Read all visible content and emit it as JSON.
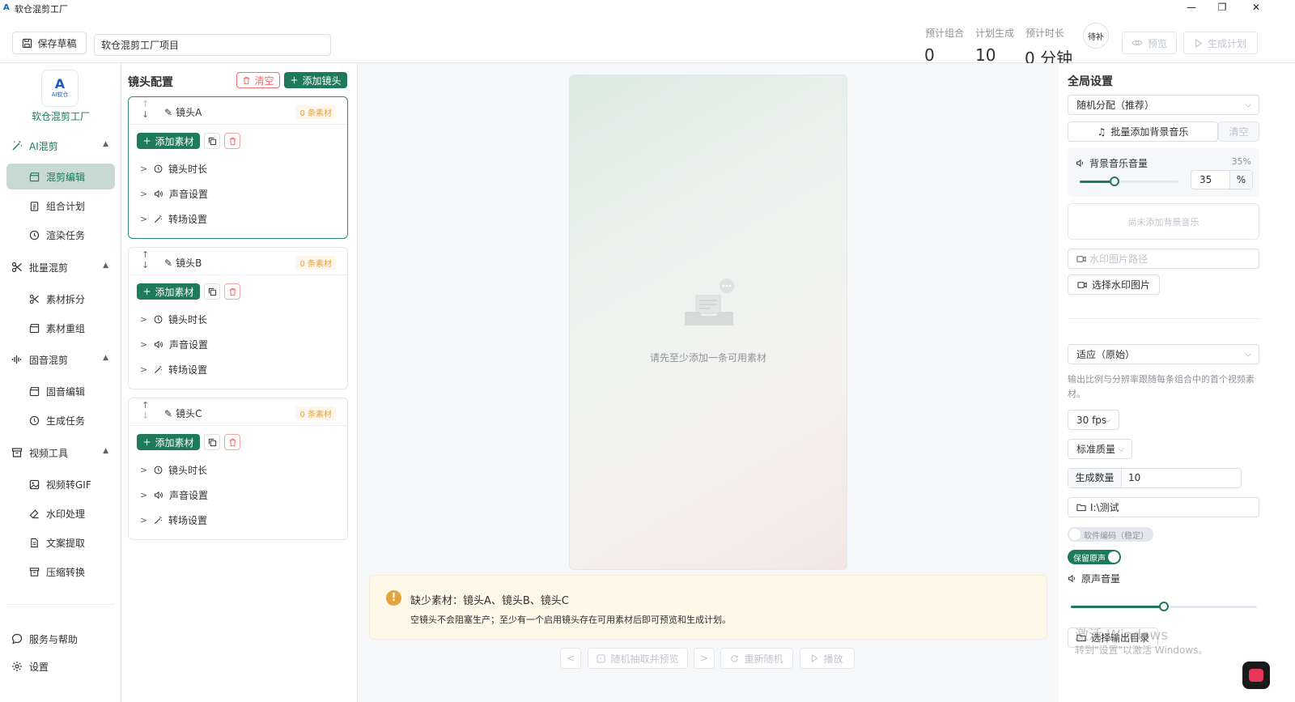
{
  "window": {
    "title": "软仓混剪工厂",
    "minimize": "—",
    "restore": "❐",
    "close": "✕"
  },
  "toolbar": {
    "save_draft": "保存草稿",
    "project_name": "软仓混剪工厂项目",
    "stats": [
      {
        "label": "预计组合",
        "value": "0"
      },
      {
        "label": "计划生成",
        "value": "10"
      },
      {
        "label": "预计时长",
        "value": "0 分钟"
      }
    ],
    "pending": "待补",
    "preview": "预览",
    "generate_plan": "生成计划"
  },
  "sidebar": {
    "logo_text": "AI软仓",
    "app_name": "软仓混剪工厂",
    "groups": [
      {
        "label": "AI混剪",
        "items": [
          "混剪编辑",
          "组合计划",
          "渲染任务"
        ]
      },
      {
        "label": "批量混剪",
        "items": [
          "素材拆分",
          "素材重组"
        ]
      },
      {
        "label": "固音混剪",
        "items": [
          "固音编辑",
          "生成任务"
        ]
      },
      {
        "label": "视频工具",
        "items": [
          "视频转GIF",
          "水印处理",
          "文案提取",
          "压缩转换"
        ]
      }
    ],
    "bottom": [
      "服务与帮助",
      "设置"
    ]
  },
  "shots": {
    "title": "镜头配置",
    "clear": "清空",
    "add_shot": "添加镜头",
    "add_material": "添加素材",
    "rows": [
      "镜头时长",
      "声音设置",
      "转场设置"
    ],
    "cards": [
      {
        "name": "镜头A",
        "badge": "0 条素材"
      },
      {
        "name": "镜头B",
        "badge": "0 条素材"
      },
      {
        "name": "镜头C",
        "badge": "0 条素材"
      }
    ]
  },
  "preview": {
    "empty_text": "请先至少添加一条可用素材",
    "warn_title": "缺少素材：镜头A、镜头B、镜头C",
    "warn_desc": "空镜头不会阻塞生产；至少有一个启用镜头存在可用素材后即可预览和生成计划。",
    "controls": {
      "prev": "<",
      "random": "随机抽取并预览",
      "next": ">",
      "rerandom": "重新随机",
      "play": "播放"
    }
  },
  "global": {
    "title": "全局设置",
    "distribution": "随机分配（推荐）",
    "batch_bgm": "批量添加背景音乐",
    "clear": "清空",
    "bgm_volume_label": "背景音乐音量",
    "bgm_volume_pct": "35%",
    "bgm_volume_value": "35",
    "bgm_volume_fraction": 0.35,
    "percent": "%",
    "no_bgm": "尚未添加背景音乐",
    "watermark_placeholder": "水印图片路径",
    "choose_watermark": "选择水印图片",
    "fit_mode": "适应（原始）",
    "fit_hint": "输出比例与分辨率跟随每条组合中的首个视频素材。",
    "fps": "30 fps",
    "quality": "标准质量",
    "gen_count_label": "生成数量",
    "gen_count": "10",
    "output_path": "I:\\测试",
    "soft_encode": "软件编码（稳定）",
    "keep_audio": "保留原声",
    "orig_volume_label": "原声音量",
    "orig_volume_fraction": 0.5,
    "choose_output": "选择输出目录",
    "activate_line1": "激活 Windows",
    "activate_line2": "转到\"设置\"以激活 Windows。"
  },
  "colors": {
    "accent": "#1f7a5c",
    "warning": "#e6a23c",
    "danger": "#f56c6c"
  }
}
